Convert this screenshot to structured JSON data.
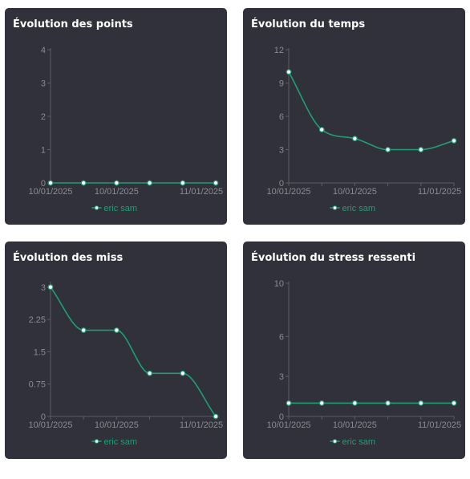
{
  "colors": {
    "card_bg": "#31313b",
    "series_line": "#1f9e75",
    "axis": "#5c5c66",
    "tick_text": "#8a8a92",
    "point_fill": "#ffffff"
  },
  "chart_data": [
    {
      "type": "line",
      "title": "Évolution des points",
      "series": [
        {
          "name": "eric sam",
          "values": [
            0,
            0,
            0,
            0,
            0,
            0
          ]
        }
      ],
      "x_tick_labels": [
        "10/01/2025",
        "10/01/2025",
        "11/01/2025"
      ],
      "y_ticks": [
        "0",
        "1",
        "2",
        "3",
        "4"
      ],
      "y_tick_values": [
        0,
        1,
        2,
        3,
        4
      ],
      "ylim": [
        0,
        4
      ],
      "legend": "bottom",
      "grid": false
    },
    {
      "type": "line",
      "title": "Évolution du temps",
      "series": [
        {
          "name": "eric sam",
          "values": [
            10,
            4.8,
            4,
            3,
            3,
            3.8
          ]
        }
      ],
      "x_tick_labels": [
        "10/01/2025",
        "10/01/2025",
        "11/01/2025"
      ],
      "y_ticks": [
        "0",
        "3",
        "6",
        "9",
        "12"
      ],
      "y_tick_values": [
        0,
        3,
        6,
        9,
        12
      ],
      "ylim": [
        0,
        12
      ],
      "legend": "bottom",
      "grid": false
    },
    {
      "type": "line",
      "title": "Évolution des miss",
      "series": [
        {
          "name": "eric sam",
          "values": [
            3,
            2,
            2,
            1,
            1,
            0
          ]
        }
      ],
      "x_tick_labels": [
        "10/01/2025",
        "10/01/2025",
        "11/01/2025"
      ],
      "y_ticks": [
        "0",
        "0.75",
        "1.5",
        "2.25",
        "3"
      ],
      "y_tick_values": [
        0,
        0.75,
        1.5,
        2.25,
        3
      ],
      "ylim": [
        0,
        3.09
      ],
      "legend": "bottom",
      "grid": false
    },
    {
      "type": "line",
      "title": "Évolution du stress ressenti",
      "series": [
        {
          "name": "eric sam",
          "values": [
            1,
            1,
            1,
            1,
            1,
            1
          ]
        }
      ],
      "x_tick_labels": [
        "10/01/2025",
        "10/01/2025",
        "11/01/2025"
      ],
      "y_ticks": [
        "0",
        "3",
        "6",
        "10"
      ],
      "y_tick_values": [
        0,
        3,
        6,
        10
      ],
      "ylim": [
        0,
        10
      ],
      "legend": "bottom",
      "grid": false
    }
  ]
}
